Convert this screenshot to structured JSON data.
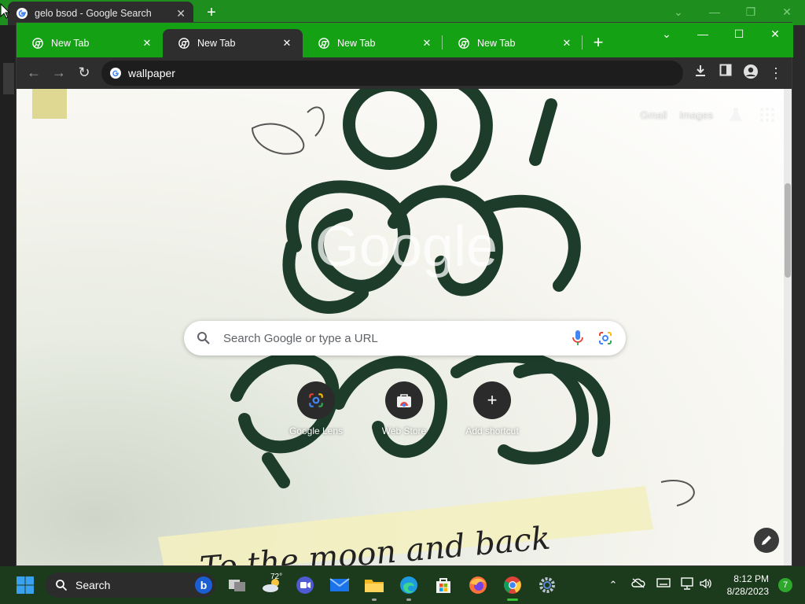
{
  "background_window": {
    "tab_title": "gelo bsod - Google Search"
  },
  "window": {
    "tabs": [
      {
        "label": "New Tab",
        "active": false
      },
      {
        "label": "New Tab",
        "active": true
      },
      {
        "label": "New Tab",
        "active": false
      },
      {
        "label": "New Tab",
        "active": false
      }
    ]
  },
  "omnibox": {
    "text": "wallpaper"
  },
  "ntp": {
    "links": [
      "Gmail",
      "Images"
    ],
    "logo_text": "Google",
    "search_placeholder": "Search Google or type a URL",
    "shortcuts": [
      {
        "label": "Google Lens",
        "icon": "google-lens-icon"
      },
      {
        "label": "Web Store",
        "icon": "web-store-icon"
      },
      {
        "label": "Add shortcut",
        "icon": "plus-icon"
      }
    ],
    "wallpaper_caption": "To the moon and back"
  },
  "taskbar": {
    "search_label": "Search",
    "weather_temp": "72°",
    "time": "8:12 PM",
    "date": "8/28/2023",
    "notification_count": "7",
    "apps": [
      "task-view",
      "weather",
      "zoom",
      "mail",
      "file-explorer",
      "edge",
      "microsoft-store",
      "firefox",
      "chrome",
      "settings"
    ]
  },
  "colors": {
    "tabstrip": "#14a114",
    "toolbar": "#2e2e2e",
    "taskbar": "#1c3a1c"
  }
}
